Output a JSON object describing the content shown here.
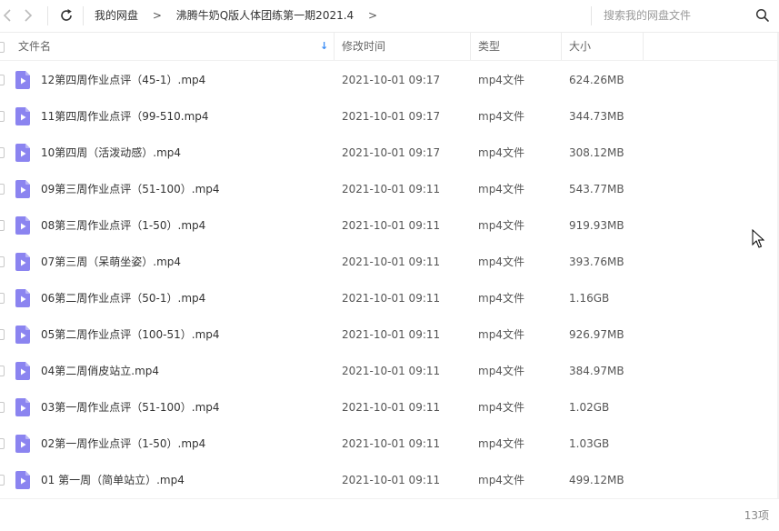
{
  "toolbar": {
    "breadcrumb": [
      "我的网盘",
      "沸腾牛奶Q版人体团练第一期2021.4"
    ],
    "breadcrumb_sep": ">",
    "search_placeholder": "搜索我的网盘文件"
  },
  "table": {
    "columns": [
      "文件名",
      "修改时间",
      "类型",
      "大小"
    ],
    "sort_indicator": "↓",
    "rows": [
      {
        "name": "12第四周作业点评（45-1）.mp4",
        "time": "2021-10-01 09:17",
        "type": "mp4文件",
        "size": "624.26MB"
      },
      {
        "name": "11第四周作业点评（99-510.mp4",
        "time": "2021-10-01 09:17",
        "type": "mp4文件",
        "size": "344.73MB"
      },
      {
        "name": "10第四周（活泼动感）.mp4",
        "time": "2021-10-01 09:17",
        "type": "mp4文件",
        "size": "308.12MB"
      },
      {
        "name": "09第三周作业点评（51-100）.mp4",
        "time": "2021-10-01 09:11",
        "type": "mp4文件",
        "size": "543.77MB"
      },
      {
        "name": "08第三周作业点评（1-50）.mp4",
        "time": "2021-10-01 09:11",
        "type": "mp4文件",
        "size": "919.93MB"
      },
      {
        "name": "07第三周（呆萌坐姿）.mp4",
        "time": "2021-10-01 09:11",
        "type": "mp4文件",
        "size": "393.76MB"
      },
      {
        "name": "06第二周作业点评（50-1）.mp4",
        "time": "2021-10-01 09:11",
        "type": "mp4文件",
        "size": "1.16GB"
      },
      {
        "name": "05第二周作业点评（100-51）.mp4",
        "time": "2021-10-01 09:11",
        "type": "mp4文件",
        "size": "926.97MB"
      },
      {
        "name": "04第二周俏皮站立.mp4",
        "time": "2021-10-01 09:11",
        "type": "mp4文件",
        "size": "384.97MB"
      },
      {
        "name": "03第一周作业点评（51-100）.mp4",
        "time": "2021-10-01 09:11",
        "type": "mp4文件",
        "size": "1.02GB"
      },
      {
        "name": "02第一周作业点评（1-50）.mp4",
        "time": "2021-10-01 09:11",
        "type": "mp4文件",
        "size": "1.03GB"
      },
      {
        "name": "01 第一周（简单站立）.mp4",
        "time": "2021-10-01 09:11",
        "type": "mp4文件",
        "size": "499.12MB"
      }
    ]
  },
  "footer": {
    "count": "13项"
  },
  "icons": {
    "back": "chevron-left-icon",
    "forward": "chevron-right-icon",
    "refresh": "refresh-icon",
    "search": "search-icon",
    "file": "video-file-icon",
    "cursor": "mouse-pointer-icon"
  },
  "colors": {
    "file_icon": "#8b84f0",
    "sort_arrow": "#3b8cf5",
    "text": "#333333",
    "muted": "#999999"
  }
}
